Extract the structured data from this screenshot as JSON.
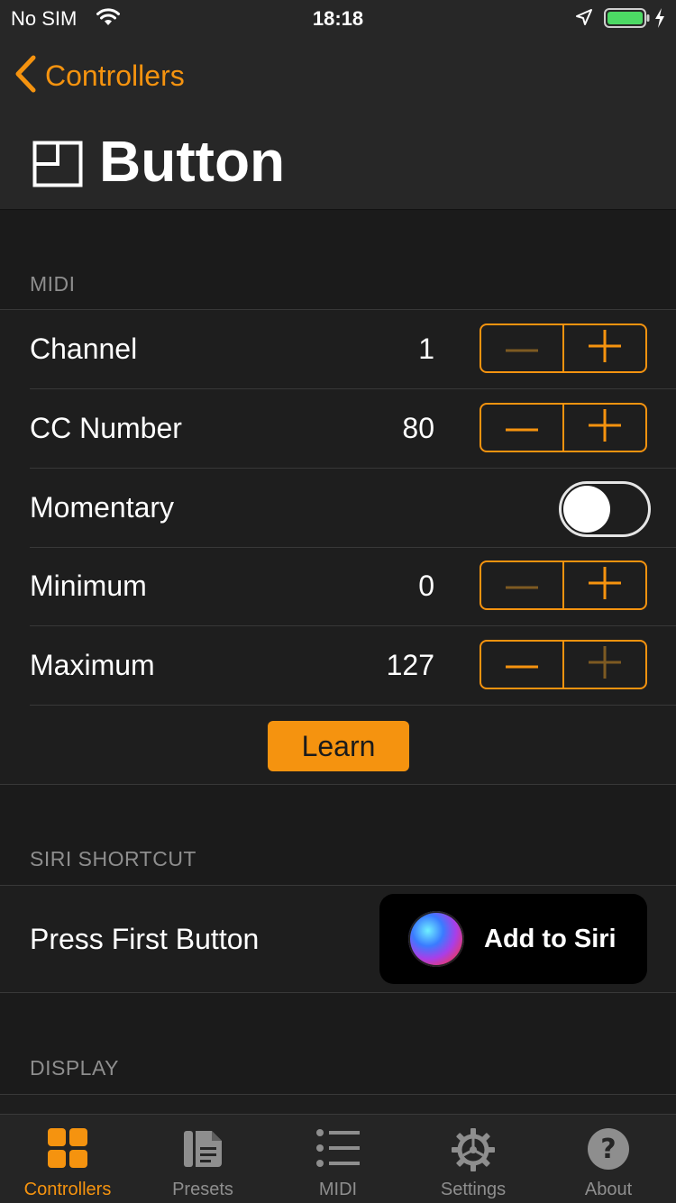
{
  "status_bar": {
    "carrier": "No SIM",
    "time": "18:18"
  },
  "nav": {
    "back_label": "Controllers",
    "title": "Button"
  },
  "midi": {
    "header": "MIDI",
    "rows": [
      {
        "label": "Channel",
        "value": "1"
      },
      {
        "label": "CC Number",
        "value": "80"
      },
      {
        "label": "Momentary",
        "toggle_on": false
      },
      {
        "label": "Minimum",
        "value": "0"
      },
      {
        "label": "Maximum",
        "value": "127"
      }
    ],
    "learn_label": "Learn"
  },
  "siri": {
    "header": "SIRI SHORTCUT",
    "row_label": "Press First Button",
    "button_label": "Add to Siri"
  },
  "display": {
    "header": "DISPLAY"
  },
  "tabs": [
    {
      "label": "Controllers",
      "icon": "grid-icon",
      "active": true
    },
    {
      "label": "Presets",
      "icon": "document-icon",
      "active": false
    },
    {
      "label": "MIDI",
      "icon": "list-icon",
      "active": false
    },
    {
      "label": "Settings",
      "icon": "gear-icon",
      "active": false
    },
    {
      "label": "About",
      "icon": "question-icon",
      "active": false
    }
  ],
  "colors": {
    "accent": "#f5930f",
    "background": "#1b1b1b",
    "bar": "#272727"
  }
}
